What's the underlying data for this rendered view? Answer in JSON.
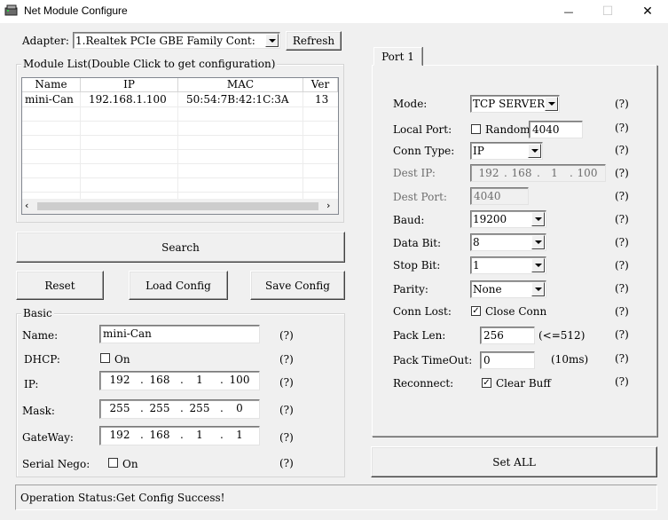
{
  "window": {
    "title": "Net Module Configure",
    "minimize_glyph": "—",
    "maximize_glyph": "☐",
    "close_glyph": "✕"
  },
  "adapter": {
    "label": "Adapter:",
    "value": "1.Realtek PCIe GBE Family Cont:",
    "refresh_label": "Refresh"
  },
  "module_list": {
    "title": "Module List(Double Click to get configuration)",
    "columns": [
      "Name",
      "IP",
      "MAC",
      "Ver"
    ],
    "rows": [
      [
        "mini-Can",
        "192.168.1.100",
        "50:54:7B:42:1C:3A",
        "13"
      ]
    ]
  },
  "buttons": {
    "search": "Search",
    "reset": "Reset",
    "load_config": "Load Config",
    "save_config": "Save Config",
    "set_all": "Set ALL"
  },
  "basic": {
    "title": "Basic",
    "name_label": "Name:",
    "name_value": "mini-Can",
    "dhcp_label": "DHCP:",
    "dhcp_on_label": "On",
    "dhcp_checked": false,
    "ip_label": "IP:",
    "ip": [
      "192",
      "168",
      "1",
      "100"
    ],
    "mask_label": "Mask:",
    "mask": [
      "255",
      "255",
      "255",
      "0"
    ],
    "gateway_label": "GateWay:",
    "gateway": [
      "192",
      "168",
      "1",
      "1"
    ],
    "serial_nego_label": "Serial Nego:",
    "serial_nego_on_label": "On",
    "serial_nego_checked": false,
    "help": "(?)"
  },
  "port": {
    "tab_label": "Port 1",
    "mode_label": "Mode:",
    "mode_value": "TCP SERVER",
    "local_port_label": "Local Port:",
    "random_label": "Random",
    "random_checked": false,
    "local_port_value": "4040",
    "conn_type_label": "Conn Type:",
    "conn_type_value": "IP",
    "dest_ip_label": "Dest IP:",
    "dest_ip": [
      "192",
      "168",
      "1",
      "100"
    ],
    "dest_port_label": "Dest Port:",
    "dest_port_value": "4040",
    "baud_label": "Baud:",
    "baud_value": "19200",
    "data_bit_label": "Data Bit:",
    "data_bit_value": "8",
    "stop_bit_label": "Stop Bit:",
    "stop_bit_value": "1",
    "parity_label": "Parity:",
    "parity_value": "None",
    "conn_lost_label": "Conn Lost:",
    "close_conn_label": "Close Conn",
    "close_conn_checked": true,
    "pack_len_label": "Pack Len:",
    "pack_len_value": "256",
    "pack_len_hint": "(<=512)",
    "pack_timeout_label": "Pack TimeOut:",
    "pack_timeout_value": "0",
    "pack_timeout_hint": "(10ms)",
    "reconnect_label": "Reconnect:",
    "clear_buff_label": "Clear Buff",
    "clear_buff_checked": true,
    "help": "(?)"
  },
  "status": {
    "text": "Operation Status:Get Config Success!"
  }
}
